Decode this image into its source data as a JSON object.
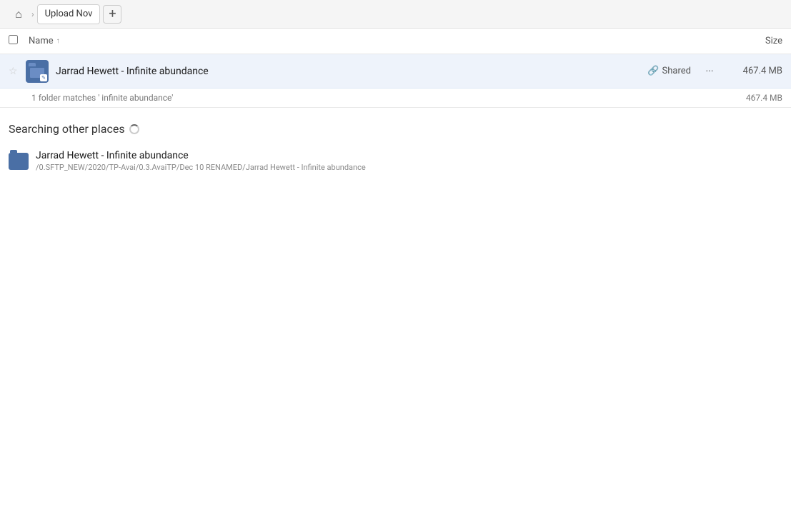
{
  "topbar": {
    "home_icon": "🏠",
    "tab_label": "Upload Nov",
    "new_tab_icon": "+"
  },
  "columns": {
    "name_label": "Name",
    "sort_icon": "↑",
    "size_label": "Size"
  },
  "main_result": {
    "star_icon": "☆",
    "folder_icon_label": "folder-with-pen",
    "name": "Jarrad Hewett - Infinite abundance",
    "shared_label": "Shared",
    "more_icon": "•••",
    "size": "467.4 MB"
  },
  "summary": {
    "text": "1 folder matches ' infinite abundance'",
    "size": "467.4 MB"
  },
  "other_section": {
    "title": "Searching other places",
    "spinner": true
  },
  "other_results": [
    {
      "name": "Jarrad Hewett - Infinite abundance",
      "path": "/0.SFTP_NEW/2020/TP-Avai/0.3.AvaiTP/Dec 10 RENAMED/Jarrad Hewett - Infinite abundance"
    }
  ]
}
